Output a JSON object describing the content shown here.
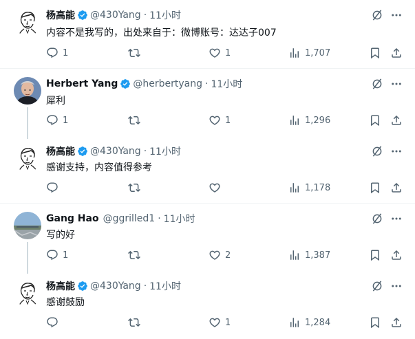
{
  "colors": {
    "accent": "#1d9bf0",
    "muted": "#536471",
    "text": "#0f1419",
    "divider": "#eff3f4"
  },
  "tweets": [
    {
      "name": "杨高能",
      "handle": "@430Yang",
      "time": "11小时",
      "text": "内容不是我写的，出处来自于：微博账号：达达子007",
      "verified": "blue",
      "replies": "1",
      "retweets": "",
      "likes": "1",
      "views": "1,707",
      "avatar": "sketch-avatar"
    },
    {
      "name": "Herbert Yang",
      "handle": "@herbertyang",
      "time": "11小时",
      "text": "犀利",
      "verified": "blue",
      "replies": "1",
      "retweets": "",
      "likes": "1",
      "views": "1,296",
      "avatar": "photo-avatar"
    },
    {
      "name": "杨高能",
      "handle": "@430Yang",
      "time": "11小时",
      "text": "感谢支持，内容值得参考",
      "verified": "blue",
      "replies": "",
      "retweets": "",
      "likes": "",
      "views": "1,178",
      "avatar": "sketch-avatar"
    },
    {
      "name": "Gang Hao",
      "handle": "@ggrilled1",
      "time": "11小时",
      "text": "写的好",
      "verified": "none",
      "replies": "1",
      "retweets": "",
      "likes": "2",
      "views": "1,387",
      "avatar": "landscape-avatar"
    },
    {
      "name": "杨高能",
      "handle": "@430Yang",
      "time": "11小时",
      "text": "感谢鼓励",
      "verified": "blue",
      "replies": "",
      "retweets": "",
      "likes": "1",
      "views": "1,284",
      "avatar": "sketch-avatar"
    }
  ],
  "separator": "·"
}
